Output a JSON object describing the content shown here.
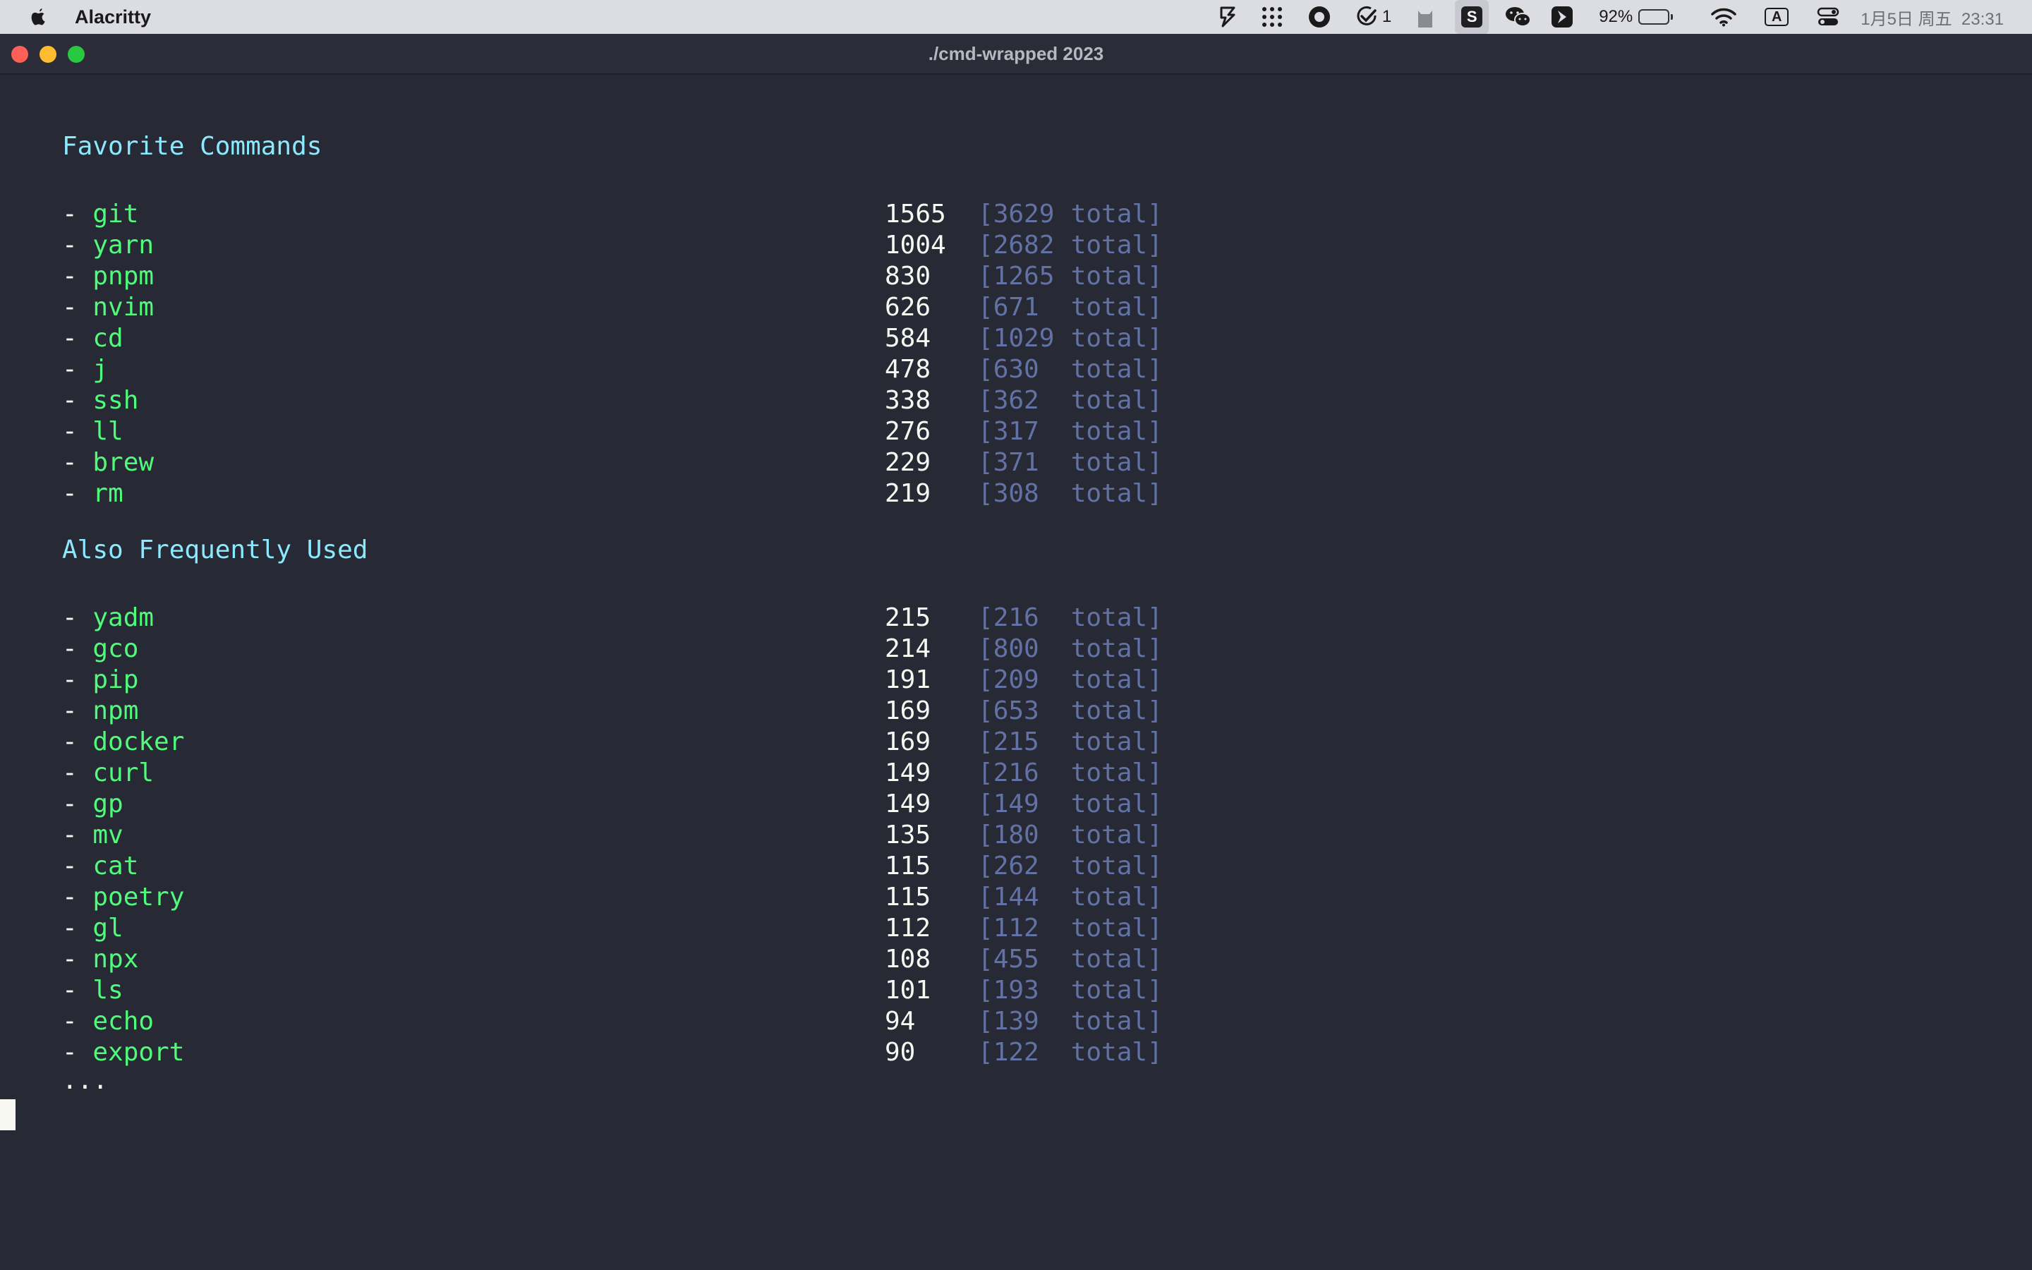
{
  "menubar": {
    "app_name": "Alacritty",
    "checks_count": "1",
    "s_label": "S",
    "battery_percent": "92%",
    "battery_level": 0.92,
    "input_label": "A",
    "datetime": "1月5日 周五  23:31"
  },
  "window": {
    "title": "./cmd-wrapped 2023"
  },
  "terminal": {
    "favorite_heading": "Favorite Commands",
    "also_heading": "Also Frequently Used",
    "dash": "- ",
    "open_bracket": "[",
    "total_suffix": "total]",
    "ellipsis": "...",
    "favorites": [
      {
        "cmd": "git",
        "count": "1565",
        "total": "3629"
      },
      {
        "cmd": "yarn",
        "count": "1004",
        "total": "2682"
      },
      {
        "cmd": "pnpm",
        "count": "830",
        "total": "1265"
      },
      {
        "cmd": "nvim",
        "count": "626",
        "total": "671"
      },
      {
        "cmd": "cd",
        "count": "584",
        "total": "1029"
      },
      {
        "cmd": "j",
        "count": "478",
        "total": "630"
      },
      {
        "cmd": "ssh",
        "count": "338",
        "total": "362"
      },
      {
        "cmd": "ll",
        "count": "276",
        "total": "317"
      },
      {
        "cmd": "brew",
        "count": "229",
        "total": "371"
      },
      {
        "cmd": "rm",
        "count": "219",
        "total": "308"
      }
    ],
    "frequent": [
      {
        "cmd": "yadm",
        "count": "215",
        "total": "216"
      },
      {
        "cmd": "gco",
        "count": "214",
        "total": "800"
      },
      {
        "cmd": "pip",
        "count": "191",
        "total": "209"
      },
      {
        "cmd": "npm",
        "count": "169",
        "total": "653"
      },
      {
        "cmd": "docker",
        "count": "169",
        "total": "215"
      },
      {
        "cmd": "curl",
        "count": "149",
        "total": "216"
      },
      {
        "cmd": "gp",
        "count": "149",
        "total": "149"
      },
      {
        "cmd": "mv",
        "count": "135",
        "total": "180"
      },
      {
        "cmd": "cat",
        "count": "115",
        "total": "262"
      },
      {
        "cmd": "poetry",
        "count": "115",
        "total": "144"
      },
      {
        "cmd": "gl",
        "count": "112",
        "total": "112"
      },
      {
        "cmd": "npx",
        "count": "108",
        "total": "455"
      },
      {
        "cmd": "ls",
        "count": "101",
        "total": "193"
      },
      {
        "cmd": "echo",
        "count": "94",
        "total": "139"
      },
      {
        "cmd": "export",
        "count": "90",
        "total": "122"
      }
    ]
  },
  "colors": {
    "background": "#272935",
    "heading": "#8be9fd",
    "command": "#50fa7b",
    "count": "#f8f8f2",
    "total": "#6272a4"
  },
  "icons": [
    "apple-icon",
    "scrivener-icon",
    "grid-icon",
    "record-icon",
    "check-icon",
    "cat-icon",
    "wechat-icon",
    "bird-icon",
    "battery-icon",
    "wifi-icon",
    "control-center-icon"
  ]
}
